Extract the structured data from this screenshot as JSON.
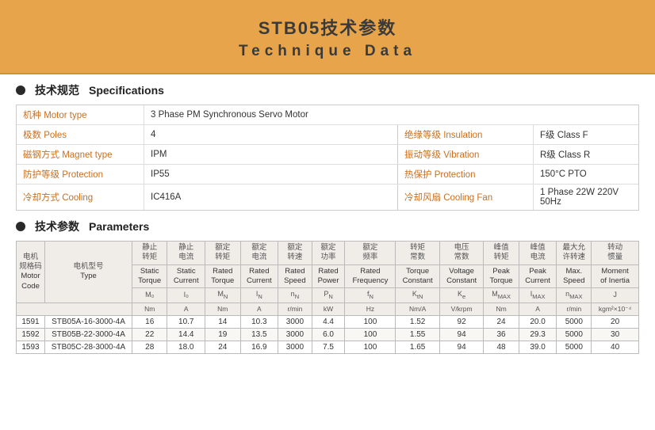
{
  "header": {
    "title_cn": "STB05技术参数",
    "title_en": "Technique Data"
  },
  "specs_section": {
    "title_cn": "技术规范",
    "title_en": "Specifications"
  },
  "params_section": {
    "title_cn": "技术参数",
    "title_en": "Parameters"
  },
  "specs": {
    "motor_type_label": "机种 Motor type",
    "motor_type_value": "3 Phase PM Synchronous Servo Motor",
    "poles_label": "极数 Poles",
    "poles_value": "4",
    "magnet_label": "磁钢方式 Magnet type",
    "magnet_value": "IPM",
    "protection_label": "防护等级 Protection",
    "protection_value": "IP55",
    "cooling_label": "冷却方式 Cooling",
    "cooling_value": "IC416A",
    "insulation_label": "绝缘等级 Insulation",
    "insulation_value": "F级  Class F",
    "vibration_label": "振动等级 Vibration",
    "vibration_value": "R级  Class R",
    "thermal_protection_label": "热保护 Protection",
    "thermal_protection_value": "150°C PTO",
    "cooling_fan_label": "冷却风扇 Cooling Fan",
    "cooling_fan_value": "1 Phase  22W  220V  50Hz"
  },
  "table": {
    "col_headers": [
      {
        "cn": "电机规格码",
        "en": "Motor Code"
      },
      {
        "cn": "电机型号",
        "en": "Type"
      },
      {
        "cn": "静止转矩",
        "sym": "M₀",
        "en": "Static Torque",
        "unit": "Nm"
      },
      {
        "cn": "静止电流",
        "sym": "I₀",
        "en": "Static Current",
        "unit": "A"
      },
      {
        "cn": "额定转矩",
        "sym": "MN",
        "en": "Rated Torque",
        "unit": "Nm"
      },
      {
        "cn": "额定电流",
        "sym": "IN",
        "en": "Rated Current",
        "unit": "A"
      },
      {
        "cn": "额定转速",
        "sym": "nN",
        "en": "Rated Speed",
        "unit": "r/min"
      },
      {
        "cn": "额定功率",
        "sym": "PN",
        "en": "Rated Power",
        "unit": "kW"
      },
      {
        "cn": "额定频率",
        "sym": "fN",
        "en": "Rated Frequency",
        "unit": "Hz"
      },
      {
        "cn": "转矩常数",
        "sym": "KtN",
        "en": "Torque Constant",
        "unit": "Nm/A"
      },
      {
        "cn": "电压常数",
        "sym": "Ke",
        "en": "Voltage Constant",
        "unit": "V/krpm"
      },
      {
        "cn": "峰值转矩",
        "sym": "MMAX",
        "en": "Peak Torque",
        "unit": "Nm"
      },
      {
        "cn": "峰值电流",
        "sym": "IMAX",
        "en": "Peak Current",
        "unit": "A"
      },
      {
        "cn": "最大允许转速",
        "sym": "nMAX",
        "en": "Max. Speed",
        "unit": "r/min"
      },
      {
        "cn": "转动惯量",
        "sym": "J",
        "en": "Moment of Inertia",
        "unit": "kgm²×10⁻⁴"
      }
    ],
    "rows": [
      {
        "code": "1591",
        "type": "STB05A-16-3000-4A",
        "M0": "16",
        "I0": "10.7",
        "MN": "14",
        "IN": "10.3",
        "nN": "3000",
        "PN": "4.4",
        "fN": "100",
        "KtN": "1.52",
        "Ke": "92",
        "MMAX": "24",
        "IMAX": "20.0",
        "nMAX": "5000",
        "J": "20"
      },
      {
        "code": "1592",
        "type": "STB05B-22-3000-4A",
        "M0": "22",
        "I0": "14.4",
        "MN": "19",
        "IN": "13.5",
        "nN": "3000",
        "PN": "6.0",
        "fN": "100",
        "KtN": "1.55",
        "Ke": "94",
        "MMAX": "36",
        "IMAX": "29.3",
        "nMAX": "5000",
        "J": "30"
      },
      {
        "code": "1593",
        "type": "STB05C-28-3000-4A",
        "M0": "28",
        "I0": "18.0",
        "MN": "24",
        "IN": "16.9",
        "nN": "3000",
        "PN": "7.5",
        "fN": "100",
        "KtN": "1.65",
        "Ke": "94",
        "MMAX": "48",
        "IMAX": "39.0",
        "nMAX": "5000",
        "J": "40"
      }
    ]
  }
}
